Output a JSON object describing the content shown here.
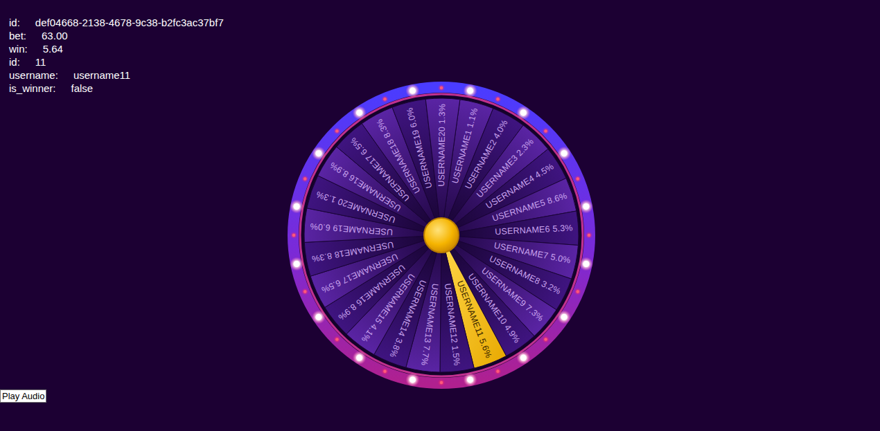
{
  "info": [
    {
      "key": "id:",
      "value": "def04668-2138-4678-9c38-b2fc3ac37bf7"
    },
    {
      "key": "bet:",
      "value": "63.00"
    },
    {
      "key": "win:",
      "value": "5.64"
    },
    {
      "key": "id:",
      "value": "11"
    },
    {
      "key": "username:",
      "value": "username11"
    },
    {
      "key": "is_winner:",
      "value": "false"
    }
  ],
  "wheel": {
    "segments": [
      {
        "label": "USERNAME1 1.1%",
        "selected": false
      },
      {
        "label": "USERNAME2 4.0%",
        "selected": false
      },
      {
        "label": "USERNAME3 2.3%",
        "selected": false
      },
      {
        "label": "USERNAME4 4.5%",
        "selected": false
      },
      {
        "label": "USERNAME5 8.6%",
        "selected": false
      },
      {
        "label": "USERNAME6 5.3%",
        "selected": false
      },
      {
        "label": "USERNAME7 5.0%",
        "selected": false
      },
      {
        "label": "USERNAME8 3.2%",
        "selected": false
      },
      {
        "label": "USERNAME9 7.3%",
        "selected": false
      },
      {
        "label": "USERNAME10 4.9%",
        "selected": false
      },
      {
        "label": "USERNAME11 5.6%",
        "selected": true
      },
      {
        "label": "USERNAME12 1.5%",
        "selected": false
      },
      {
        "label": "USERNAME13 7.7%",
        "selected": false
      },
      {
        "label": "USERNAME14 3.8%",
        "selected": false
      },
      {
        "label": "USERNAME15 4.1%",
        "selected": false
      },
      {
        "label": "USERNAME16 8.9%",
        "selected": false
      },
      {
        "label": "USERNAME17 6.5%",
        "selected": false
      },
      {
        "label": "USERNAME18 8.3%",
        "selected": false
      },
      {
        "label": "USERNAME19 6.0%",
        "selected": false
      },
      {
        "label": "USERNAME20 1.3%",
        "selected": false
      },
      {
        "label": "USERNAME16 8.9%",
        "selected": false
      },
      {
        "label": "USERNAME17 6.5%",
        "selected": false
      },
      {
        "label": "USERNAME18 8.3%",
        "selected": false
      },
      {
        "label": "USERNAME19 6.0%",
        "selected": false
      },
      {
        "label": "USERNAME20 1.3%",
        "selected": false
      }
    ]
  },
  "button": "Play Audio"
}
